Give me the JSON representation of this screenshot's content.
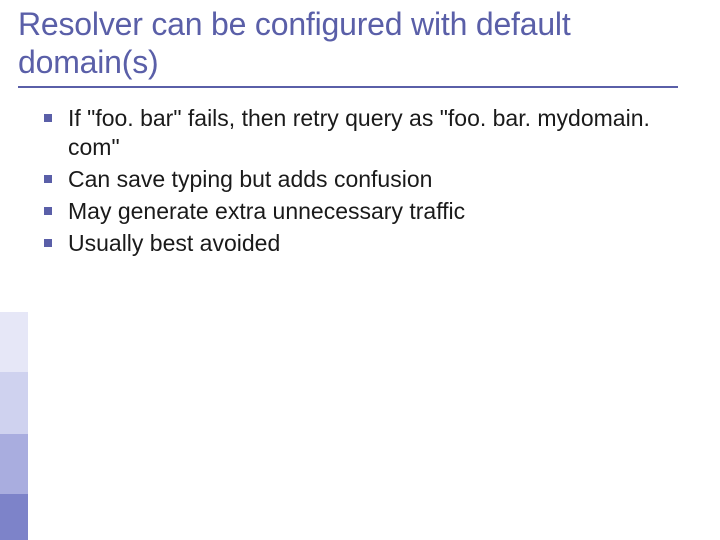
{
  "slide": {
    "title": "Resolver can be configured with default domain(s)",
    "bullets": [
      "If \"foo. bar\" fails, then retry query as \"foo. bar. mydomain. com\"",
      "Can save typing but adds confusion",
      "May generate extra unnecessary traffic",
      "Usually best avoided"
    ]
  }
}
